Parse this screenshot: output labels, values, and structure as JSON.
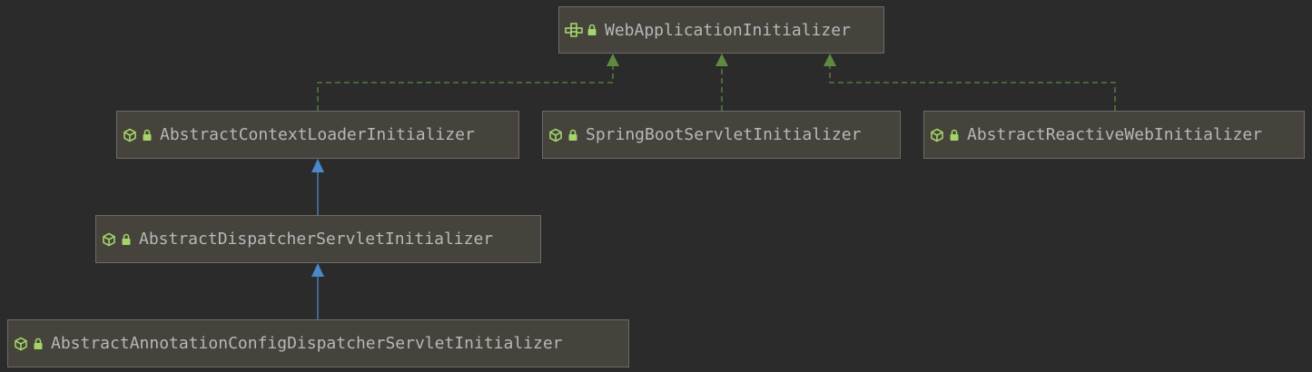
{
  "diagram": {
    "nodes": [
      {
        "id": "webappinit",
        "kind": "interface",
        "label": "WebApplicationInitializer"
      },
      {
        "id": "ctxloader",
        "kind": "abstract-class",
        "label": "AbstractContextLoaderInitializer"
      },
      {
        "id": "springboot",
        "kind": "abstract-class",
        "label": "SpringBootServletInitializer"
      },
      {
        "id": "reactive",
        "kind": "abstract-class",
        "label": "AbstractReactiveWebInitializer"
      },
      {
        "id": "dispatcher",
        "kind": "abstract-class",
        "label": "AbstractDispatcherServletInitializer"
      },
      {
        "id": "annotation",
        "kind": "abstract-class",
        "label": "AbstractAnnotationConfigDispatcherServletInitializer"
      }
    ],
    "edges": [
      {
        "from": "ctxloader",
        "to": "webappinit",
        "relation": "implements"
      },
      {
        "from": "springboot",
        "to": "webappinit",
        "relation": "implements"
      },
      {
        "from": "reactive",
        "to": "webappinit",
        "relation": "implements"
      },
      {
        "from": "dispatcher",
        "to": "ctxloader",
        "relation": "extends"
      },
      {
        "from": "annotation",
        "to": "dispatcher",
        "relation": "extends"
      }
    ],
    "colors": {
      "background": "#2b2b2b",
      "node_fill": "#45433b",
      "node_border": "#6b6b6b",
      "label_text": "#b6b8ba",
      "implements_edge": "#5f8a3f",
      "extends_edge": "#4a88c7",
      "icon_green": "#a5d46a"
    },
    "icons": {
      "interface": "interface-icon",
      "abstract-class": "abstract-class-icon",
      "visibility": "lock-icon"
    }
  }
}
